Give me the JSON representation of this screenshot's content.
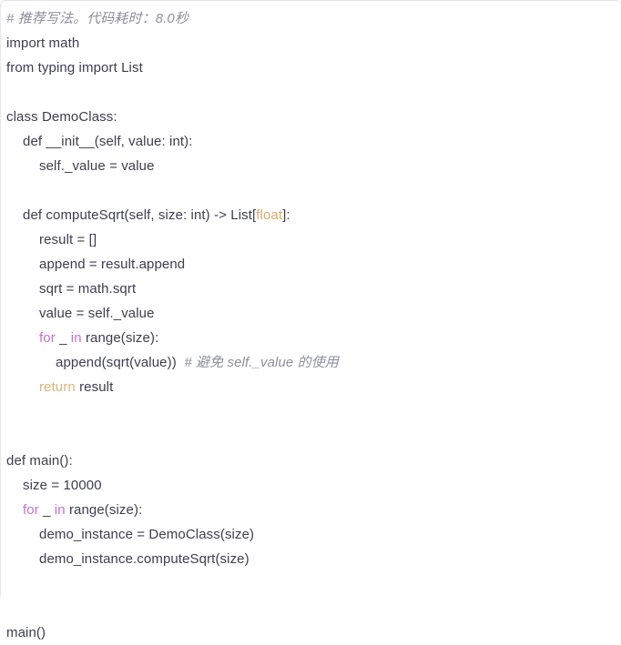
{
  "editor": {
    "language": "python",
    "background": "#ffffff",
    "colors": {
      "text": "#3d3d52",
      "comment": "#8e8ea0",
      "keyword": "#c96fd0",
      "type": "#dba96a",
      "return_keyword": "#dcb67a",
      "border": "#e3e3e6"
    }
  },
  "code": {
    "lines": [
      {
        "indent": 0,
        "segments": [
          {
            "text": "# 推荐写法。代码耗时：8.0秒",
            "kind": "comment"
          }
        ]
      },
      {
        "indent": 0,
        "segments": [
          {
            "text": "import math",
            "kind": "plain"
          }
        ]
      },
      {
        "indent": 0,
        "segments": [
          {
            "text": "from typing import List",
            "kind": "plain"
          }
        ]
      },
      {
        "indent": 0,
        "segments": [
          {
            "text": "",
            "kind": "blank"
          }
        ]
      },
      {
        "indent": 0,
        "segments": [
          {
            "text": "class DemoClass:",
            "kind": "plain"
          }
        ]
      },
      {
        "indent": 1,
        "segments": [
          {
            "text": "def __init__(self, value: int):",
            "kind": "plain"
          }
        ]
      },
      {
        "indent": 2,
        "segments": [
          {
            "text": "self._value = value",
            "kind": "plain"
          }
        ]
      },
      {
        "indent": 0,
        "segments": [
          {
            "text": "",
            "kind": "blank"
          }
        ]
      },
      {
        "indent": 1,
        "segments": [
          {
            "text": "def computeSqrt(self, size: int) -> List[",
            "kind": "plain"
          },
          {
            "text": "float",
            "kind": "type"
          },
          {
            "text": "]:",
            "kind": "plain"
          }
        ]
      },
      {
        "indent": 2,
        "segments": [
          {
            "text": "result = []",
            "kind": "plain"
          }
        ]
      },
      {
        "indent": 2,
        "segments": [
          {
            "text": "append = result.append",
            "kind": "plain"
          }
        ]
      },
      {
        "indent": 2,
        "segments": [
          {
            "text": "sqrt = math.sqrt",
            "kind": "plain"
          }
        ]
      },
      {
        "indent": 2,
        "segments": [
          {
            "text": "value = self._value",
            "kind": "plain"
          }
        ]
      },
      {
        "indent": 2,
        "segments": [
          {
            "text": "for",
            "kind": "keyword"
          },
          {
            "text": " _ ",
            "kind": "plain"
          },
          {
            "text": "in",
            "kind": "keyword"
          },
          {
            "text": " range(size):",
            "kind": "plain"
          }
        ]
      },
      {
        "indent": 3,
        "segments": [
          {
            "text": "append(sqrt(value))  ",
            "kind": "plain"
          },
          {
            "text": "# 避免 self._value 的使用",
            "kind": "comment"
          }
        ]
      },
      {
        "indent": 2,
        "segments": [
          {
            "text": "return",
            "kind": "return"
          },
          {
            "text": " result",
            "kind": "plain"
          }
        ]
      },
      {
        "indent": 0,
        "segments": [
          {
            "text": "",
            "kind": "blank"
          }
        ]
      },
      {
        "indent": 0,
        "segments": [
          {
            "text": "",
            "kind": "blank"
          }
        ]
      },
      {
        "indent": 0,
        "segments": [
          {
            "text": "def main():",
            "kind": "plain"
          }
        ]
      },
      {
        "indent": 1,
        "segments": [
          {
            "text": "size = 10000",
            "kind": "plain"
          }
        ]
      },
      {
        "indent": 1,
        "segments": [
          {
            "text": "for",
            "kind": "keyword"
          },
          {
            "text": " _ ",
            "kind": "plain"
          },
          {
            "text": "in",
            "kind": "keyword"
          },
          {
            "text": " range(size):",
            "kind": "plain"
          }
        ]
      },
      {
        "indent": 2,
        "segments": [
          {
            "text": "demo_instance = DemoClass(size)",
            "kind": "plain"
          }
        ]
      },
      {
        "indent": 2,
        "segments": [
          {
            "text": "demo_instance.computeSqrt(size)",
            "kind": "plain"
          }
        ]
      },
      {
        "indent": 0,
        "segments": [
          {
            "text": "",
            "kind": "blank"
          }
        ]
      },
      {
        "indent": 0,
        "segments": [
          {
            "text": "",
            "kind": "blank"
          }
        ]
      },
      {
        "indent": 0,
        "segments": [
          {
            "text": "main()",
            "kind": "plain"
          }
        ]
      }
    ]
  }
}
